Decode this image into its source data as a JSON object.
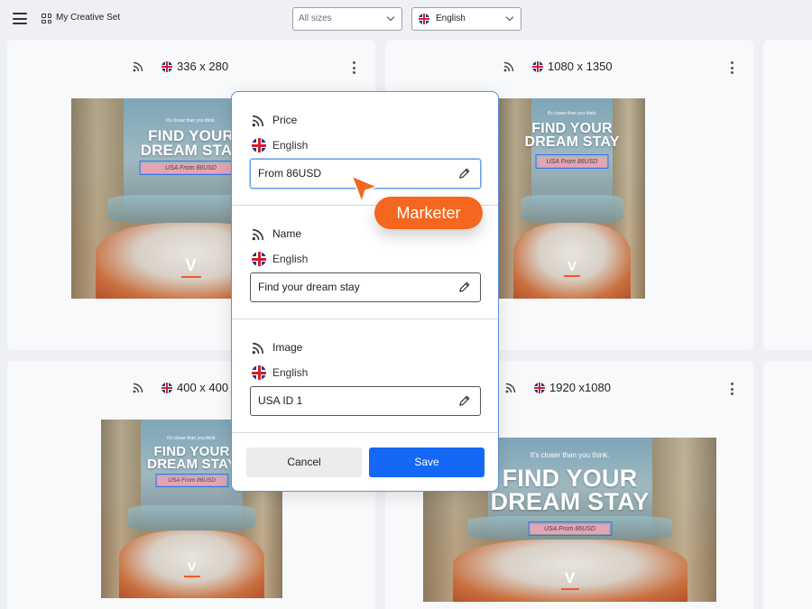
{
  "header": {
    "set_title": "My Creative Set",
    "sizes_select": {
      "value": "All sizes"
    },
    "language_select": {
      "value": "English"
    }
  },
  "cards": [
    {
      "size": "336 x 280",
      "ad": {
        "tagline": "It's closer than you think.",
        "headline_1": "FIND YOUR",
        "headline_2": "DREAM STAY",
        "price": "USA From 86USD",
        "logo": "V"
      }
    },
    {
      "size": "1080 x 1350",
      "ad": {
        "tagline": "It's closer than you think.",
        "headline_1": "FIND YOUR",
        "headline_2": "DREAM STAY",
        "price": "USA From 86USD",
        "logo": "V"
      }
    },
    {
      "size": "400 x 400",
      "ad": {
        "tagline": "It's closer than you think.",
        "headline_1": "FIND YOUR",
        "headline_2": "DREAM STAY",
        "price": "USA From 86USD",
        "logo": "V"
      }
    },
    {
      "size": "1920 x1080",
      "ad": {
        "tagline": "It's closer than you think.",
        "headline_1": "FIND YOUR",
        "headline_2": "DREAM STAY",
        "price": "USA From 86USD",
        "logo": "V"
      }
    }
  ],
  "modal": {
    "sections": [
      {
        "title": "Price",
        "language": "English",
        "value": "From 86USD"
      },
      {
        "title": "Name",
        "language": "English",
        "value": "Find your dream stay"
      },
      {
        "title": "Image",
        "language": "English",
        "value": "USA ID 1"
      }
    ],
    "cancel_label": "Cancel",
    "save_label": "Save"
  },
  "collaborator": {
    "label": "Marketer",
    "color": "#f5661f"
  },
  "colors": {
    "accent": "#1468f5",
    "focus_border": "#5b93d8",
    "price_highlight": "#e4a4b4"
  },
  "icons": [
    "menu-icon",
    "grid-icon",
    "chevron-down-icon",
    "uk-flag-icon",
    "feed-icon",
    "more-vertical-icon",
    "pencil-icon",
    "cursor-arrow-icon"
  ]
}
